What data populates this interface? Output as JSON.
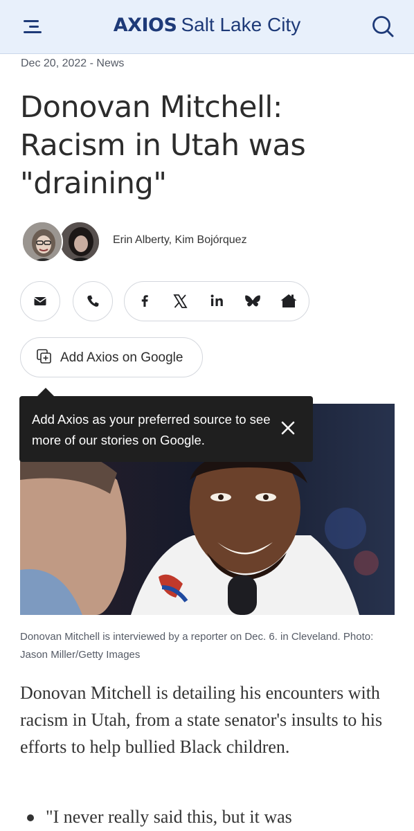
{
  "header": {
    "logo_text": "AXIOS",
    "city": "Salt Lake City",
    "menu_icon": "hamburger-menu-icon",
    "search_icon": "search-icon",
    "bar_color": "#e8f0fb",
    "brand_color": "#1e3a78"
  },
  "article": {
    "dateline": "Dec 20, 2022 - News",
    "headline": "Donovan Mitchell: Racism in Utah was \"draining\"",
    "authors": "Erin Alberty, Kim Bojórquez",
    "image_caption": "Donovan Mitchell is interviewed by a reporter on Dec. 6. in Cleveland. Photo: Jason Miller/Getty Images",
    "lede": "Donovan Mitchell is detailing his encounters with racism in Utah, from a state senator's insults to his efforts to help bullied Black children.",
    "bullet_1": "\"I never really said this, but it was"
  },
  "share": {
    "email_icon": "email-icon",
    "phone_icon": "phone-icon",
    "facebook_icon": "facebook-icon",
    "x_icon": "x-icon",
    "linkedin_icon": "linkedin-icon",
    "bluesky_icon": "bluesky-icon",
    "home_icon": "home-icon"
  },
  "google_button": {
    "label": "Add Axios on Google",
    "icon": "add-source-icon"
  },
  "tooltip": {
    "text": "Add Axios as your preferred source to see more of our stories on Google.",
    "close_icon": "close-icon"
  }
}
